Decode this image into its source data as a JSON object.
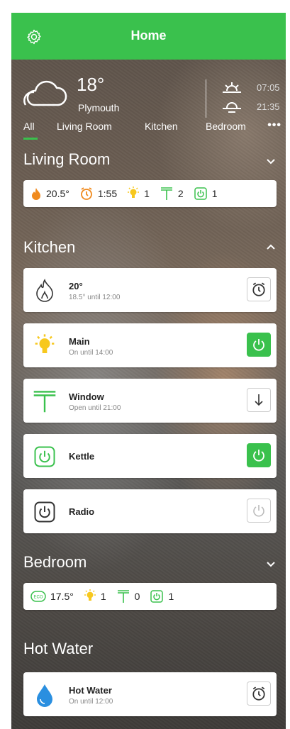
{
  "header": {
    "title": "Home"
  },
  "weather": {
    "temperature": "18°",
    "location": "Plymouth",
    "sunrise": "07:05",
    "sunset": "21:35"
  },
  "tabs": [
    "All",
    "Living Room",
    "Kitchen",
    "Bedroom"
  ],
  "tabs_more": "•••",
  "sections": {
    "living_room": {
      "title": "Living Room",
      "summary": {
        "heat": "20.5°",
        "timer": "1:55",
        "lights": "1",
        "windows": "2",
        "plugs": "1"
      }
    },
    "kitchen": {
      "title": "Kitchen",
      "devices": [
        {
          "name": "20°",
          "sub": "18.5° until 12:00"
        },
        {
          "name": "Main",
          "sub": "On until 14:00"
        },
        {
          "name": "Window",
          "sub": "Open until 21:00"
        },
        {
          "name": "Kettle"
        },
        {
          "name": "Radio"
        }
      ]
    },
    "bedroom": {
      "title": "Bedroom",
      "summary": {
        "eco": "17.5°",
        "lights": "1",
        "windows": "0",
        "plugs": "1"
      }
    },
    "hot_water": {
      "title": "Hot Water",
      "device": {
        "name": "Hot Water",
        "sub": "On until 12:00"
      }
    }
  },
  "icons": {
    "eco_label": "ECO"
  },
  "colors": {
    "accent": "#3ac14d",
    "flame": "#f08a1d",
    "bulb": "#f7c81e",
    "water": "#2a8fe0"
  }
}
